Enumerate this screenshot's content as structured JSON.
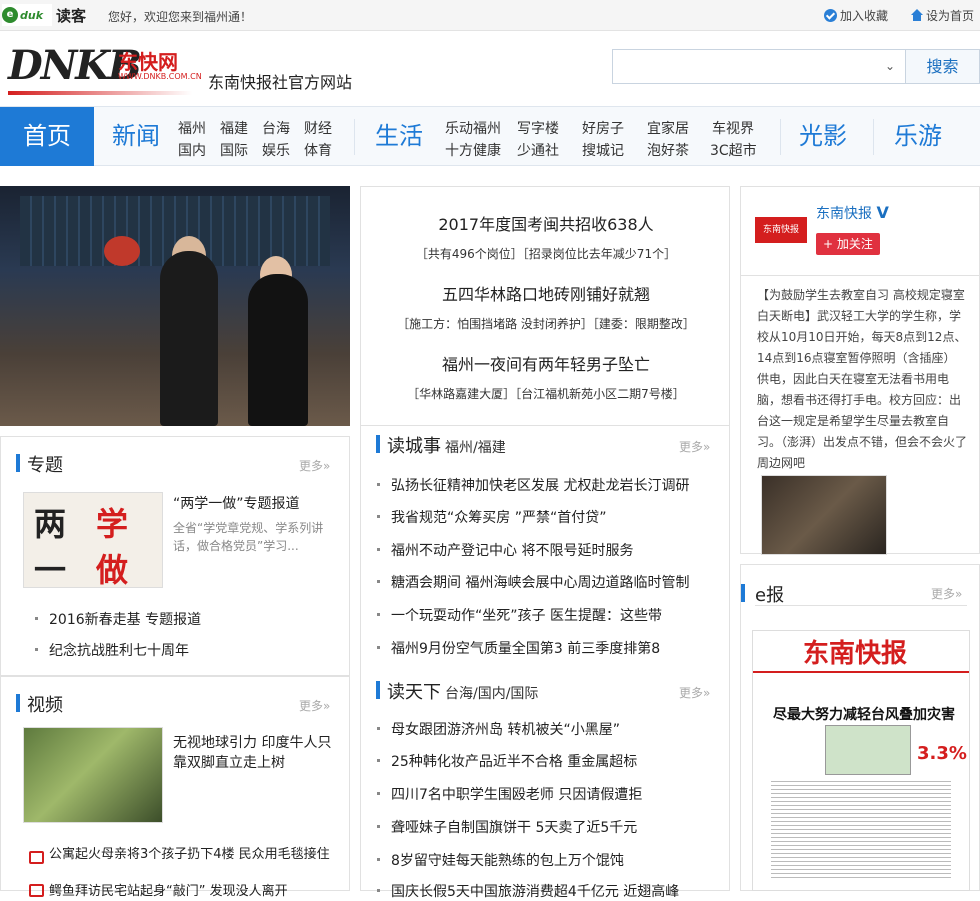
{
  "topbar": {
    "logo_text": "读客",
    "welcome": "您好，欢迎您来到福州通！",
    "favorite": "加入收藏",
    "set_home": "设为首页"
  },
  "header": {
    "logo_letters": "DNKB",
    "logo_cn": "东快网",
    "logo_url": "WWW.DNKB.COM.CN",
    "slogan": "东南快报社官方网站",
    "search_placeholder": "",
    "search_button": "搜索"
  },
  "nav": {
    "home": "首页",
    "news": "新闻",
    "news_sub": [
      [
        "福州",
        "福建",
        "台海",
        "财经"
      ],
      [
        "国内",
        "国际",
        "娱乐",
        "体育"
      ]
    ],
    "life": "生活",
    "life_sub": [
      [
        "乐动福州",
        "写字楼",
        "好房子",
        "宜家居",
        "车视界"
      ],
      [
        "十方健康",
        "少通社",
        "搜城记",
        "泡好茶",
        "3C超市"
      ]
    ],
    "film": "光影",
    "travel": "乐游"
  },
  "headlines": [
    {
      "title": "2017年度国考闽共招收638人",
      "sub": "［共有496个岗位］［招录岗位比去年减少71个］"
    },
    {
      "title": "五四华林路口地砖刚铺好就翘",
      "sub": "［施工方：怕围挡堵路 没封闭养护］［建委：限期整改］"
    },
    {
      "title": "福州一夜间有两年轻男子坠亡",
      "sub": "［华林路嘉建大厦］［台江福机新苑小区二期7号楼］"
    }
  ],
  "weibo": {
    "name": "东南快报",
    "follow": "加关注",
    "text": "【为鼓励学生去教室自习 高校规定寝室白天断电】武汉轻工大学的学生称，学校从10月10日开始，每天8点到12点、14点到16点寝室暂停照明（含插座）供电，因此白天在寝室无法看书用电脑，想看书还得打手电。校方回应：出台这一规定是希望学生尽量去教室自习。（澎湃）出发点不错，但会不会火了周边网吧"
  },
  "more": "更多",
  "zhuanti": {
    "title": "专题",
    "feature_title": "“两学一做”专题报道",
    "feature_desc": "全省“学党章党规、学系列讲话，做合格党员”学习...",
    "items": [
      "2016新春走基 专题报道",
      "纪念抗战胜利七十周年"
    ]
  },
  "video": {
    "title": "视频",
    "feature_title": "无视地球引力 印度牛人只靠双脚直立走上树",
    "items": [
      "公寓起火母亲将3个孩子扔下4楼 民众用毛毯接住",
      "鳄鱼拜访民宅站起身“敲门” 发现没人离开"
    ]
  },
  "ducheng": {
    "title": "读城事",
    "sub": "福州/福建",
    "items": [
      "弘扬长征精神加快老区发展 尤权赴龙岩长汀调研",
      "我省规范“众筹买房 ”严禁“首付贷”",
      "福州不动产登记中心 将不限号延时服务",
      "糖酒会期间 福州海峡会展中心周边道路临时管制",
      "一个玩耍动作“坐死”孩子 医生提醒：这些带",
      "福州9月份空气质量全国第3 前三季度排第8"
    ]
  },
  "dutianxia": {
    "title": "读天下",
    "sub": "台海/国内/国际",
    "items": [
      "母女跟团游济州岛 转机被关“小黑屋”",
      "25种韩化妆产品近半不合格 重金属超标",
      "四川7名中职学生围殴老师 只因请假遭拒",
      "聋哑妹子自制国旗饼干 5天卖了近5千元",
      "8岁留守娃每天能熟练的包上万个馄饨",
      "国庆长假5天中国旅游消费超4千亿元 近翅高峰"
    ]
  },
  "ebao": {
    "title": "e报",
    "paper_name": "东南快报",
    "headline": "尽最大努力减轻台风叠加灾害",
    "big_num": "3.3%"
  }
}
